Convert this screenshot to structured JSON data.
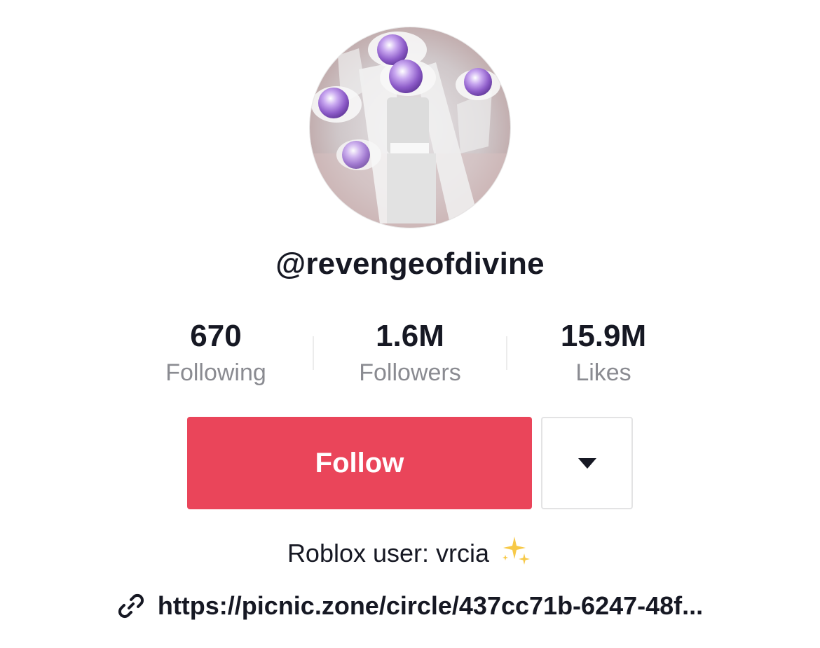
{
  "profile": {
    "avatar_icon": "profile-avatar",
    "username": "@revengeofdivine"
  },
  "stats": [
    {
      "value": "670",
      "label": "Following"
    },
    {
      "value": "1.6M",
      "label": "Followers"
    },
    {
      "value": "15.9M",
      "label": "Likes"
    }
  ],
  "actions": {
    "follow_label": "Follow",
    "follow_color": "#ea455a",
    "more_icon": "caret-down-icon"
  },
  "bio": {
    "text": "Roblox user: vrcia",
    "emoji_icon": "sparkles-icon"
  },
  "link": {
    "icon": "link-icon",
    "text": "https://picnic.zone/circle/437cc71b-6247-48f..."
  }
}
